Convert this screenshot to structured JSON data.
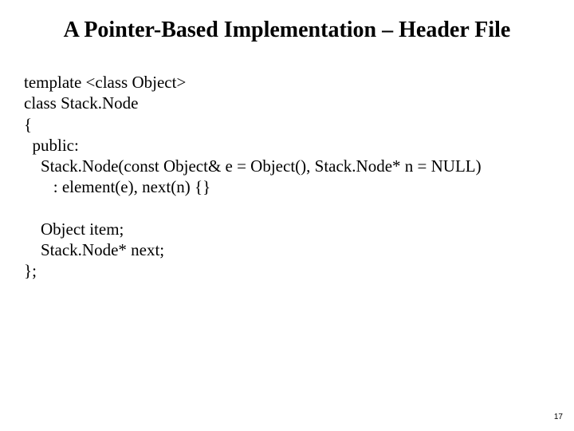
{
  "title": "A Pointer-Based Implementation – Header File",
  "code": {
    "l1": "template <class Object>",
    "l2": "class Stack.Node",
    "l3": "{",
    "l4": "  public:",
    "l5": "    Stack.Node(const Object& e = Object(), Stack.Node* n = NULL)",
    "l6": "       : element(e), next(n) {}",
    "l7": "",
    "l8": "    Object item;",
    "l9": "    Stack.Node* next;",
    "l10": "};"
  },
  "page_number": "17"
}
